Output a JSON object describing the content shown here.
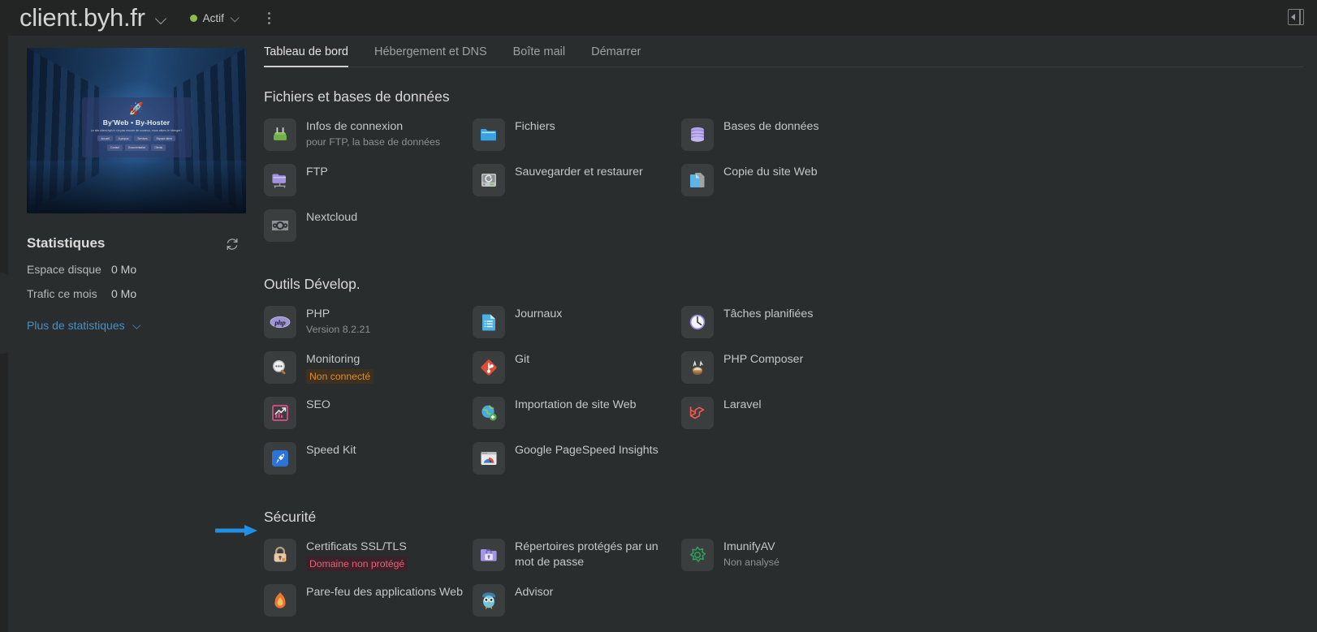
{
  "topbar": {
    "domain": "client.byh.fr",
    "domain_caret": "chevron-down",
    "status_label": "Actif",
    "status_color": "#8cba4c",
    "kebab_label": "",
    "panel_toggle_label": ""
  },
  "sidebar": {
    "preview": {
      "brand": "By'Web • By-Hoster",
      "subtitle": "Le site client.byh.fr n'a pas encore de contenu, nous allons le hberger !",
      "rocket": "🚀",
      "buttons_row1": [
        "Accueil",
        "À propos",
        "Services",
        "Espace client"
      ],
      "buttons_row2": [
        "Contact",
        "Documentation",
        "Clients"
      ]
    },
    "stats": {
      "title": "Statistiques",
      "refresh_icon": "refresh-icon",
      "rows": [
        {
          "label": "Espace disque",
          "value": "0 Mo"
        },
        {
          "label": "Trafic ce mois",
          "value": "0 Mo"
        }
      ],
      "more_link": "Plus de statistiques"
    }
  },
  "main": {
    "tabs": [
      {
        "label": "Tableau de bord",
        "active": true
      },
      {
        "label": "Hébergement et DNS",
        "active": false
      },
      {
        "label": "Boîte mail",
        "active": false
      },
      {
        "label": "Démarrer",
        "active": false
      }
    ],
    "sections": [
      {
        "title": "Fichiers et bases de données",
        "items": [
          {
            "label": "Infos de connexion",
            "sub": "pour FTP, la base de données",
            "icon": "plug-icon"
          },
          {
            "label": "Fichiers",
            "sub": "",
            "icon": "folder-icon"
          },
          {
            "label": "Bases de données",
            "sub": "",
            "icon": "database-icon"
          },
          {
            "label": "FTP",
            "sub": "",
            "icon": "ftp-folder-icon"
          },
          {
            "label": "Sauvegarder et restaurer",
            "sub": "",
            "icon": "hard-drive-icon"
          },
          {
            "label": "Copie du site Web",
            "sub": "",
            "icon": "copy-pages-icon"
          },
          {
            "label": "Nextcloud",
            "sub": "",
            "icon": "nextcloud-icon"
          }
        ]
      },
      {
        "title": "Outils Dévelop.",
        "items": [
          {
            "label": "PHP",
            "sub": "Version 8.2.21",
            "icon": "php-icon"
          },
          {
            "label": "Journaux",
            "sub": "",
            "icon": "logs-icon"
          },
          {
            "label": "Tâches planifiées",
            "sub": "",
            "icon": "clock-icon"
          },
          {
            "label": "Monitoring",
            "badge": "Non connecté",
            "badge_type": "warn",
            "icon": "monitoring-icon"
          },
          {
            "label": "Git",
            "sub": "",
            "icon": "git-icon"
          },
          {
            "label": "PHP Composer",
            "sub": "",
            "icon": "composer-icon"
          },
          {
            "label": "SEO",
            "sub": "",
            "icon": "seo-chart-icon"
          },
          {
            "label": "Importation de site Web",
            "sub": "",
            "icon": "globe-import-icon"
          },
          {
            "label": "Laravel",
            "sub": "",
            "icon": "laravel-icon"
          },
          {
            "label": "Speed Kit",
            "sub": "",
            "icon": "rocket-icon"
          },
          {
            "label": "Google PageSpeed Insights",
            "sub": "",
            "icon": "pagespeed-icon"
          }
        ]
      },
      {
        "title": "Sécurité",
        "items": [
          {
            "label": "Certificats SSL/TLS",
            "badge": "Domaine non protégé",
            "badge_type": "danger",
            "icon": "lock-icon"
          },
          {
            "label": "Répertoires protégés par un mot de passe",
            "sub": "",
            "icon": "protected-folder-icon"
          },
          {
            "label": "ImunifyAV",
            "sub": "Non analysé",
            "icon": "imunify-icon"
          },
          {
            "label": "Pare-feu des applications Web",
            "sub": "",
            "icon": "firewall-flame-icon"
          },
          {
            "label": "Advisor",
            "sub": "",
            "icon": "owl-icon"
          }
        ]
      }
    ]
  },
  "annotation": {
    "arrow_color": "#1e90e8",
    "points_to": "Certificats SSL/TLS"
  }
}
